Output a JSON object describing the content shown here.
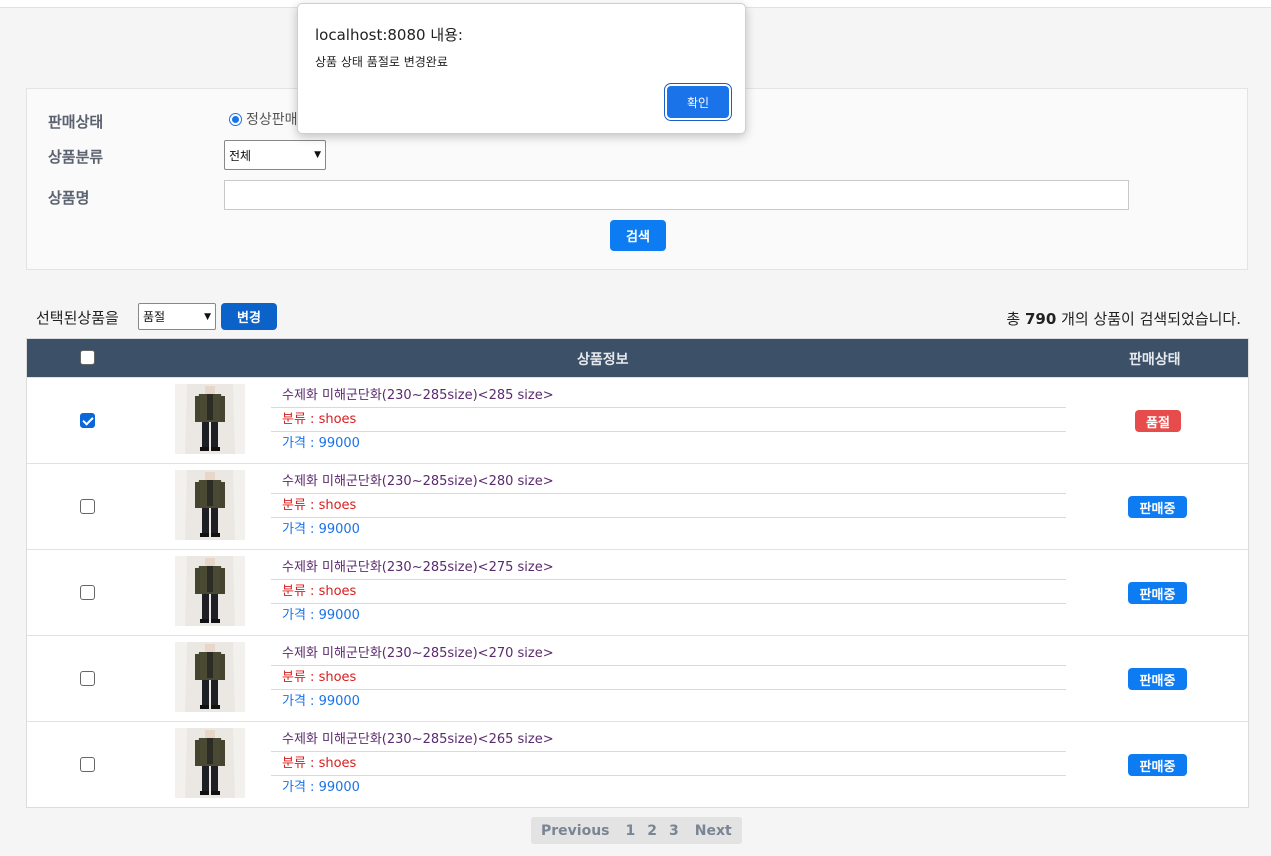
{
  "search": {
    "status_label": "판매상태",
    "status_option": "정상판매",
    "category_label": "상품분류",
    "category_value": "전체",
    "name_label": "상품명",
    "name_value": "",
    "search_button": "검색"
  },
  "bulk": {
    "label": "선택된상품을",
    "select_value": "품절",
    "change_button": "변경"
  },
  "total": {
    "prefix": "총",
    "count": "790",
    "suffix": "개의 상품이 검색되었습니다."
  },
  "table": {
    "headers": {
      "info": "상품정보",
      "status": "판매상태"
    },
    "rows": [
      {
        "name": "수제화 미해군단화(230~285size)<285 size>",
        "category": "분류 : shoes",
        "price": "가격 : 99000",
        "status": "품절",
        "checked": true
      },
      {
        "name": "수제화 미해군단화(230~285size)<280 size>",
        "category": "분류 : shoes",
        "price": "가격 : 99000",
        "status": "판매중",
        "checked": false
      },
      {
        "name": "수제화 미해군단화(230~285size)<275 size>",
        "category": "분류 : shoes",
        "price": "가격 : 99000",
        "status": "판매중",
        "checked": false
      },
      {
        "name": "수제화 미해군단화(230~285size)<270 size>",
        "category": "분류 : shoes",
        "price": "가격 : 99000",
        "status": "판매중",
        "checked": false
      },
      {
        "name": "수제화 미해군단화(230~285size)<265 size>",
        "category": "분류 : shoes",
        "price": "가격 : 99000",
        "status": "판매중",
        "checked": false
      }
    ]
  },
  "pagination": {
    "previous": "Previous",
    "pages": [
      "1",
      "2",
      "3"
    ],
    "next": "Next"
  },
  "dialog": {
    "title": "localhost:8080 내용:",
    "message": "상품 상태 품절로 변경완료",
    "ok_button": "확인"
  },
  "colors": {
    "header_bg": "#3c5068",
    "primary": "#0d7cf2",
    "soldout": "#e74c4c",
    "on_sale": "#0d7cf2"
  }
}
